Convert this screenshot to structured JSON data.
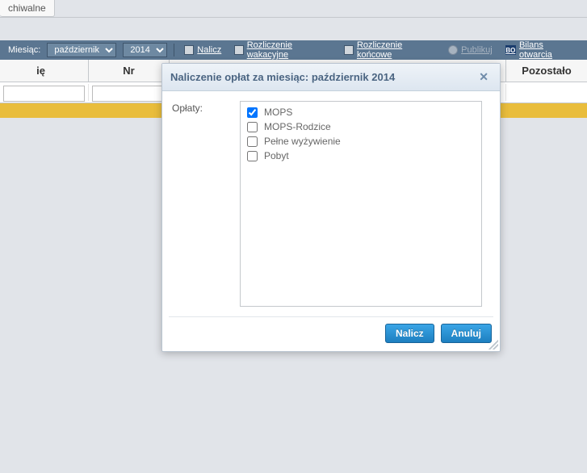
{
  "tabs": {
    "archived_label": "chiwalne"
  },
  "toolbar": {
    "month_label": "Miesiąc:",
    "month_value": "październik",
    "year_value": "2014",
    "nalicz_label": "Nalicz",
    "rozl_wakacyjne_label": "Rozliczenie wakacyjne",
    "rozl_koncowe_label": "Rozliczenie końcowe",
    "publikuj_label": "Publikuj",
    "bilans_label": "Bilans otwarcia"
  },
  "table": {
    "col_ie": "ię",
    "col_nr": "Nr",
    "col_pozostalo": "Pozostało"
  },
  "dialog": {
    "title": "Naliczenie opłat za miesiąc: październik 2014",
    "field_label": "Opłaty:",
    "options": [
      {
        "label": "MOPS",
        "checked": true
      },
      {
        "label": "MOPS-Rodzice",
        "checked": false
      },
      {
        "label": "Pełne wyżywienie",
        "checked": false
      },
      {
        "label": "Pobyt",
        "checked": false
      }
    ],
    "btn_nalicz": "Nalicz",
    "btn_anuluj": "Anuluj"
  }
}
